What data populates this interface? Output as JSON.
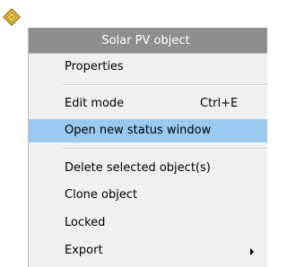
{
  "icon": {
    "name": "solar-pv-object-icon",
    "accent_color": "#c89a00"
  },
  "menu": {
    "header": "Solar PV object",
    "highlight_color": "#99c9ef",
    "items": [
      {
        "label": "Properties"
      },
      {
        "label": "Edit mode",
        "shortcut": "Ctrl+E"
      },
      {
        "label": "Open new status window"
      },
      {
        "label": "Delete selected object(s)"
      },
      {
        "label": "Clone object"
      },
      {
        "label": "Locked"
      },
      {
        "label": "Export"
      }
    ]
  }
}
